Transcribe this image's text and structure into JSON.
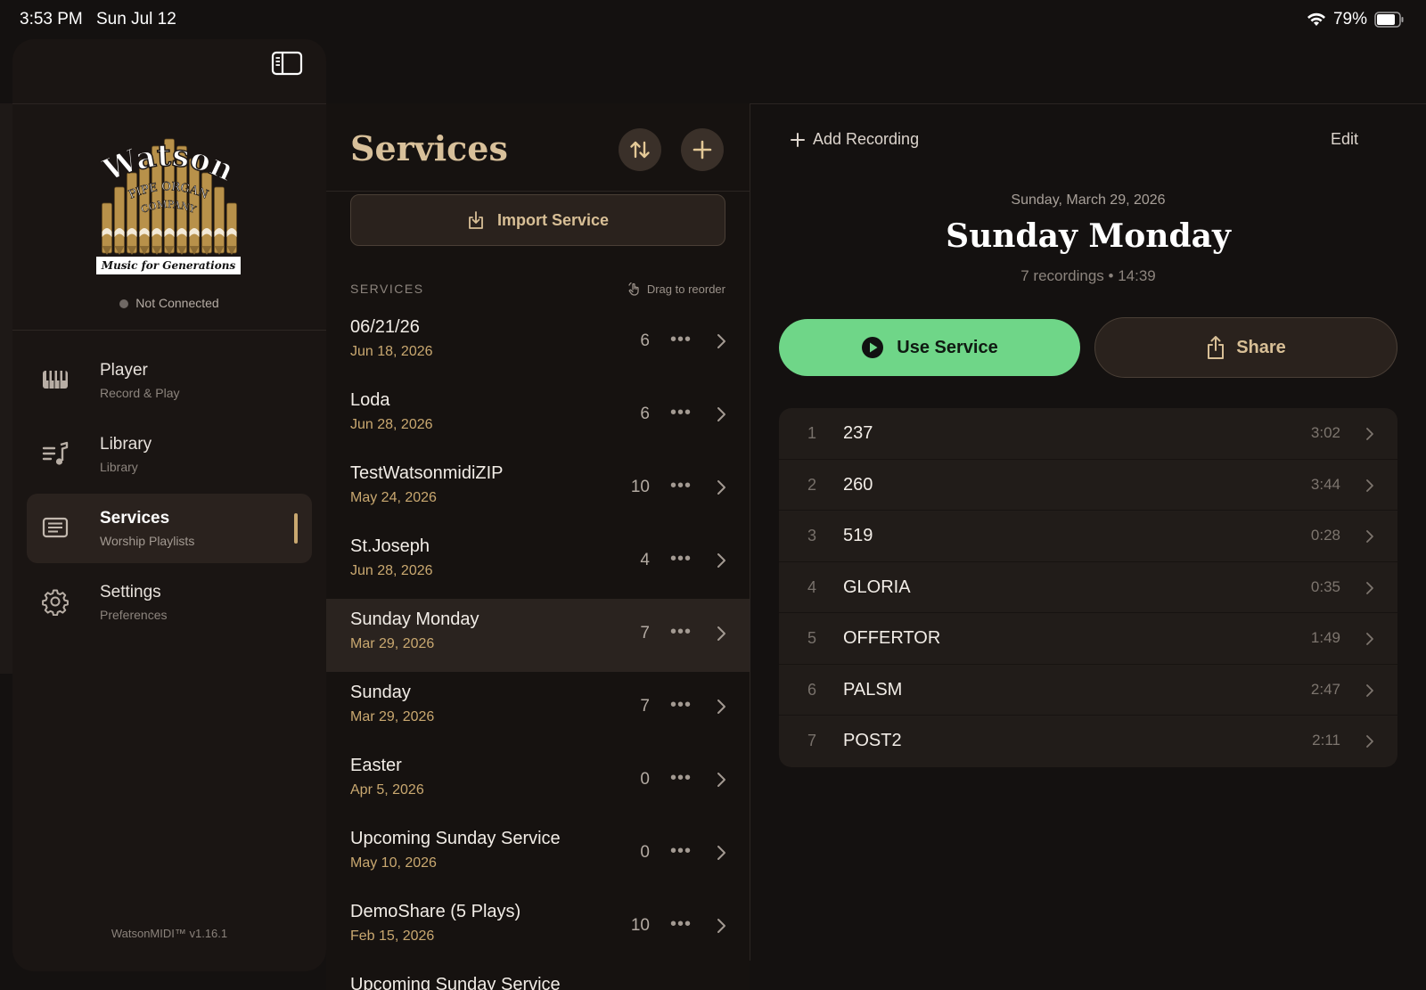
{
  "status_bar": {
    "time": "3:53 PM",
    "date": "Sun Jul 12",
    "battery": "79%"
  },
  "sidebar": {
    "logo": {
      "line1": "Watson",
      "line2": "PIPE ORGAN",
      "line3": "COMPANY",
      "tagline": "Music for Generations"
    },
    "connection_status": "Not Connected",
    "nav": [
      {
        "title": "Player",
        "subtitle": "Record & Play",
        "icon": "piano-icon"
      },
      {
        "title": "Library",
        "subtitle": "Library",
        "icon": "music-list-icon"
      },
      {
        "title": "Services",
        "subtitle": "Worship Playlists",
        "icon": "list-doc-icon",
        "active": true
      },
      {
        "title": "Settings",
        "subtitle": "Preferences",
        "icon": "gear-icon"
      }
    ],
    "version": "WatsonMIDI™ v1.16.1"
  },
  "list": {
    "title": "Services",
    "import_label": "Import Service",
    "section_label": "SERVICES",
    "drag_hint": "Drag to reorder",
    "rows": [
      {
        "name": "06/21/26",
        "date": "Jun 18, 2026",
        "count": "6",
        "more": "•••"
      },
      {
        "name": "Loda",
        "date": "Jun 28, 2026",
        "count": "6",
        "more": "•••"
      },
      {
        "name": "TestWatsonmidiZIP",
        "date": "May 24, 2026",
        "count": "10",
        "more": "•••"
      },
      {
        "name": "St.Joseph",
        "date": "Jun 28, 2026",
        "count": "4",
        "more": "•••"
      },
      {
        "name": "Sunday Monday",
        "date": "Mar 29, 2026",
        "count": "7",
        "more": "•••",
        "selected": true
      },
      {
        "name": "Sunday",
        "date": "Mar 29, 2026",
        "count": "7",
        "more": "•••"
      },
      {
        "name": "Easter",
        "date": "Apr 5, 2026",
        "count": "0",
        "more": "•••"
      },
      {
        "name": "Upcoming Sunday Service",
        "date": "May 10, 2026",
        "count": "0",
        "more": "•••"
      },
      {
        "name": "DemoShare (5 Plays)",
        "date": "Feb 15, 2026",
        "count": "10",
        "more": "•••"
      },
      {
        "name": "Upcoming Sunday Service",
        "date": "",
        "count": "",
        "more": ""
      }
    ]
  },
  "detail": {
    "add_recording": "Add Recording",
    "edit": "Edit",
    "date": "Sunday, March 29, 2026",
    "title": "Sunday Monday",
    "meta": "7 recordings • 14:39",
    "use_label": "Use Service",
    "share_label": "Share",
    "tracks": [
      {
        "num": "1",
        "name": "237",
        "duration": "3:02"
      },
      {
        "num": "2",
        "name": "260",
        "duration": "3:44"
      },
      {
        "num": "3",
        "name": "519",
        "duration": "0:28"
      },
      {
        "num": "4",
        "name": "GLORIA",
        "duration": "0:35"
      },
      {
        "num": "5",
        "name": "OFFERTOR",
        "duration": "1:49"
      },
      {
        "num": "6",
        "name": "PALSM",
        "duration": "2:47"
      },
      {
        "num": "7",
        "name": "POST2",
        "duration": "2:11"
      }
    ]
  },
  "colors": {
    "accent_gold": "#c9a870",
    "use_green": "#6fd688",
    "background": "#141110"
  }
}
